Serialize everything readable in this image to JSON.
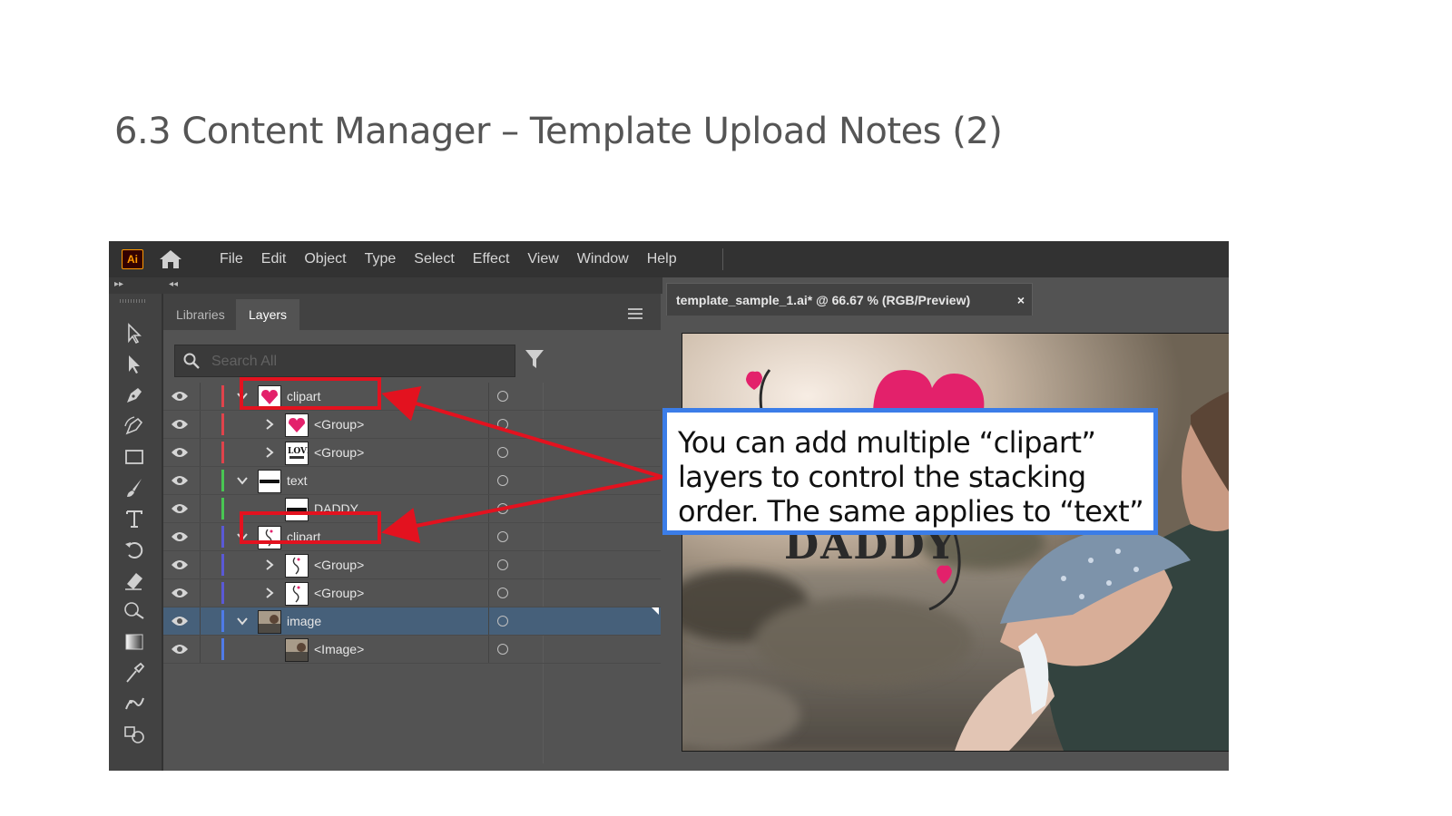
{
  "slide": {
    "title": "6.3 Content Manager – Template Upload Notes (2)"
  },
  "app": {
    "logo_text": "Ai",
    "menu": [
      "File",
      "Edit",
      "Object",
      "Type",
      "Select",
      "Effect",
      "View",
      "Window",
      "Help"
    ]
  },
  "panel": {
    "tabs": [
      "Libraries",
      "Layers"
    ],
    "active_tab": "Layers",
    "search_placeholder": "Search All"
  },
  "layers": [
    {
      "name": "clipart",
      "level": 0,
      "expanded": true,
      "color": "#e0434b",
      "thumb": "hearts"
    },
    {
      "name": "<Group>",
      "level": 1,
      "expanded": false,
      "color": "#e0434b",
      "thumb": "hearts"
    },
    {
      "name": "<Group>",
      "level": 1,
      "expanded": false,
      "color": "#e0434b",
      "thumb": "love"
    },
    {
      "name": "text",
      "level": 0,
      "expanded": true,
      "color": "#49c653",
      "thumb": "text"
    },
    {
      "name": "DADDY",
      "level": 1,
      "expanded": null,
      "color": "#49c653",
      "thumb": "text"
    },
    {
      "name": "clipart",
      "level": 0,
      "expanded": true,
      "color": "#5a59d6",
      "thumb": "vine"
    },
    {
      "name": "<Group>",
      "level": 1,
      "expanded": false,
      "color": "#5a59d6",
      "thumb": "vine"
    },
    {
      "name": "<Group>",
      "level": 1,
      "expanded": false,
      "color": "#5a59d6",
      "thumb": "vine"
    },
    {
      "name": "image",
      "level": 0,
      "expanded": true,
      "color": "#4f7be8",
      "thumb": "photo",
      "selected": true
    },
    {
      "name": "<Image>",
      "level": 1,
      "expanded": null,
      "color": "#4f7be8",
      "thumb": "photo"
    }
  ],
  "document": {
    "tab_title": "template_sample_1.ai* @ 66.67 % (RGB/Preview)",
    "close_glyph": "×",
    "artwork_text": "DADDY"
  },
  "callout": {
    "text": "You can add multiple “clipart” layers to control the stacking order. The same applies to “text” and “image”."
  },
  "colors": {
    "highlight": "#e3121f",
    "callout_border": "#3b7de8",
    "selected_row": "#46607a"
  }
}
